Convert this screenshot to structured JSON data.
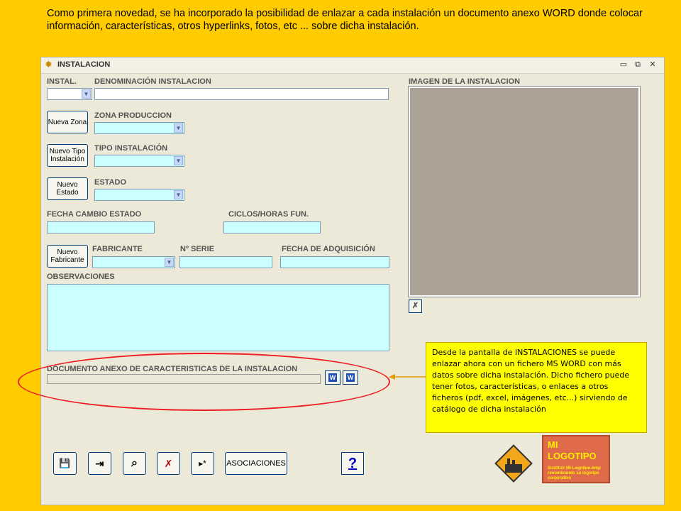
{
  "intro_text": "Como primera novedad, se ha incorporado la posibilidad de enlazar a cada instalación un documento anexo WORD donde colocar información, características, otros hyperlinks, fotos, etc ... sobre dicha instalación.",
  "window": {
    "title": "INSTALACION",
    "minimize": "▭",
    "restore": "⧉",
    "close": "✕"
  },
  "labels": {
    "instal": "INSTAL.",
    "denominacion": "DENOMINACIÓN INSTALACION",
    "zona": "ZONA PRODUCCION",
    "tipo": "TIPO INSTALACIÓN",
    "estado": "ESTADO",
    "fecha_cambio": "FECHA CAMBIO ESTADO",
    "ciclos": "CICLOS/HORAS FUN.",
    "fabricante": "FABRICANTE",
    "serie": "Nº SERIE",
    "fecha_adq": "FECHA DE ADQUISICIÓN",
    "observaciones": "OBSERVACIONES",
    "imagen": "IMAGEN DE LA INSTALACION",
    "documento": "DOCUMENTO ANEXO DE CARACTERISTICAS DE LA INSTALACION"
  },
  "buttons": {
    "nueva_zona": "Nueva Zona",
    "nuevo_tipo": "Nuevo Tipo Instalación",
    "nuevo_estado": "Nuevo Estado",
    "nuevo_fabricante": "Nuevo Fabricante",
    "asociaciones": "ASOCIACIONES",
    "help": "?"
  },
  "callout_text": "Desde la pantalla de INSTALACIONES se puede enlazar ahora con un fichero MS WORD con más datos sobre dicha instalación. Dicho fichero puede tener fotos, características, o enlaces a otros ficheros (pdf, excel, imágenes, etc...) sirviendo de catálogo de dicha instalación",
  "logo": {
    "title": "MI LOGOTIPO",
    "subtitle": "Sustituir Mi-Logotipo.bmp renombrando su logotipo corporativo"
  },
  "icons": {
    "save": "💾",
    "exit": "⇥",
    "search": "⌕",
    "delete": "✗",
    "next": "▸*",
    "image_delete": "✗",
    "word": "W"
  },
  "colors": {
    "background": "#ffcc00",
    "callout": "#ffff00",
    "highlight": "#ee1c25",
    "field": "#ccffff"
  }
}
